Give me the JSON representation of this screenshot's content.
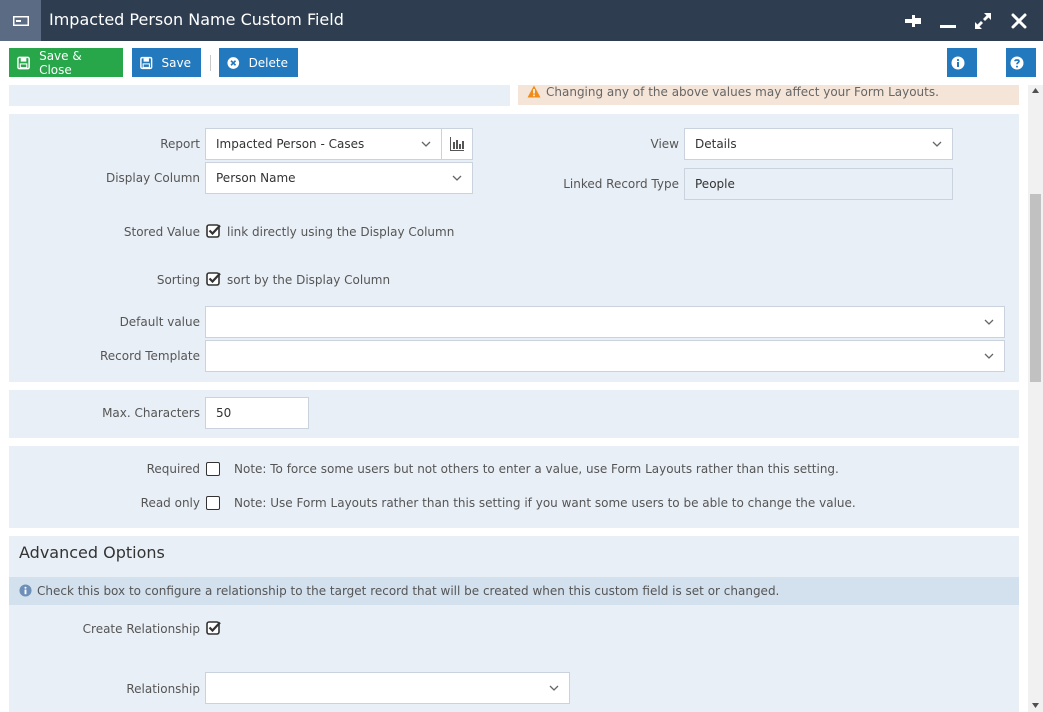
{
  "window": {
    "title": "Impacted Person Name Custom Field"
  },
  "toolbar": {
    "save_close_label": "Save & Close",
    "save_label": "Save",
    "delete_label": "Delete"
  },
  "warning": {
    "text": "Changing any of the above values may affect your Form Layouts."
  },
  "report_section": {
    "report_label": "Report",
    "report_value": "Impacted Person - Cases",
    "display_column_label": "Display Column",
    "display_column_value": "Person Name",
    "view_label": "View",
    "view_value": "Details",
    "linked_record_type_label": "Linked Record Type",
    "linked_record_type_value": "People",
    "stored_value_label": "Stored Value",
    "stored_value_text": "link directly using the Display Column",
    "stored_value_checked": true,
    "sorting_label": "Sorting",
    "sorting_text": "sort by the Display Column",
    "sorting_checked": true,
    "default_value_label": "Default value",
    "default_value_value": "",
    "record_template_label": "Record Template",
    "record_template_value": ""
  },
  "max_chars": {
    "label": "Max. Characters",
    "value": "50"
  },
  "flags": {
    "required_label": "Required",
    "required_note": "Note: To force some users but not others to enter a value, use Form Layouts rather than this setting.",
    "required_checked": false,
    "readonly_label": "Read only",
    "readonly_note": "Note: Use Form Layouts rather than this setting if you want some users to be able to change the value.",
    "readonly_checked": false
  },
  "advanced": {
    "heading": "Advanced Options",
    "info_text": "Check this box to configure a relationship to the target record that will be created when this custom field is set or changed.",
    "create_relationship_label": "Create Relationship",
    "create_relationship_checked": true,
    "relationship_label": "Relationship",
    "relationship_value": ""
  },
  "colors": {
    "titlebar": "#2e3e50",
    "accent_blue": "#2379be",
    "accent_green": "#27a74a",
    "panel_bg": "#e9eff7",
    "warning_bg": "#f4e5d8"
  },
  "icons": [
    "window-icon",
    "pin-icon",
    "minimize-icon",
    "maximize-icon",
    "close-icon",
    "save-icon",
    "delete-icon",
    "info-icon",
    "help-icon",
    "chart-icon",
    "warning-icon",
    "chevron-down-icon",
    "checkmark-icon"
  ]
}
